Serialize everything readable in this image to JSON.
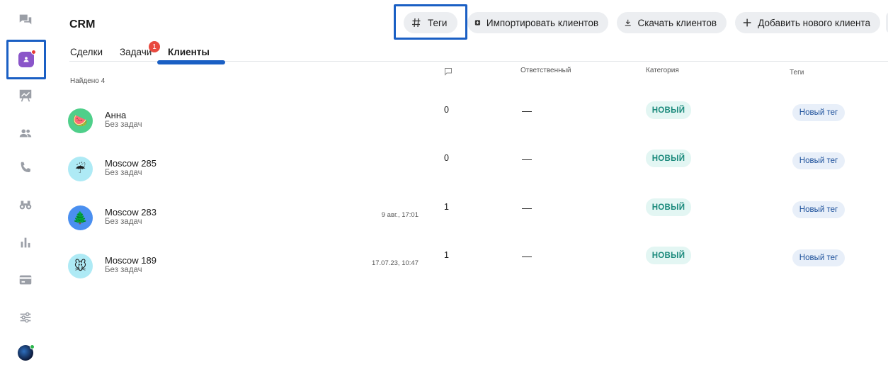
{
  "sidebar": {
    "items": [
      {
        "icon": "chat-icon"
      },
      {
        "icon": "crm-contact-icon",
        "active": true
      },
      {
        "icon": "presentation-chart-icon"
      },
      {
        "icon": "people-icon"
      },
      {
        "icon": "phone-icon"
      },
      {
        "icon": "binoculars-icon"
      },
      {
        "icon": "bar-chart-icon"
      },
      {
        "icon": "credit-card-icon"
      },
      {
        "icon": "sliders-icon"
      }
    ],
    "user_avatar_icon": "user-avatar"
  },
  "header": {
    "title": "CRM",
    "buttons": {
      "tags": "Теги",
      "import": "Импортировать клиентов",
      "download": "Скачать клиентов",
      "add": "Добавить нового клиента"
    }
  },
  "tabs": {
    "deals": "Сделки",
    "tasks": "Задачи",
    "tasks_badge": "1",
    "clients": "Клиенты"
  },
  "table": {
    "found": "Найдено 4",
    "headers": {
      "responsible": "Ответственный",
      "category": "Категория",
      "tags": "Теги"
    },
    "rows": [
      {
        "name": "Анна",
        "status": "Без задач",
        "date": "",
        "count": "0",
        "responsible": "—",
        "category": "НОВЫЙ",
        "tag": "Новый тег",
        "avatar_emoji": "🍉",
        "avatar_bg": "#4fcf8a"
      },
      {
        "name": "Moscow 285",
        "status": "Без задач",
        "date": "",
        "count": "0",
        "responsible": "—",
        "category": "НОВЫЙ",
        "tag": "Новый тег",
        "avatar_emoji": "☔",
        "avatar_bg": "#aeeaf5"
      },
      {
        "name": "Moscow 283",
        "status": "Без задач",
        "date": "9 авг., 17:01",
        "count": "1",
        "responsible": "—",
        "category": "НОВЫЙ",
        "tag": "Новый тег",
        "avatar_emoji": "🌲",
        "avatar_bg": "#4a8ff0"
      },
      {
        "name": "Moscow 189",
        "status": "Без задач",
        "date": "17.07.23, 10:47",
        "count": "1",
        "responsible": "—",
        "category": "НОВЫЙ",
        "tag": "Новый тег",
        "avatar_emoji": "🐭",
        "avatar_bg": "#aeeaf5"
      }
    ]
  },
  "colors": {
    "accent": "#1a5fc4",
    "badge_red": "#e8493f",
    "category_text": "#1b8a7c",
    "tag_text": "#1b4f9a"
  }
}
